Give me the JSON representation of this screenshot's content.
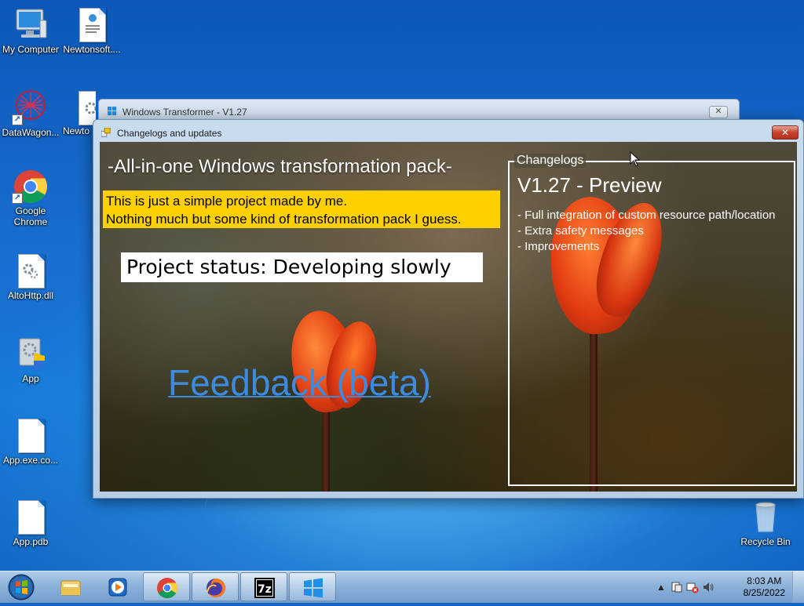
{
  "desktop": {
    "icons": [
      {
        "label": "My Computer",
        "icon": "computer-icon"
      },
      {
        "label": "Newtonsoft....",
        "icon": "document-icon"
      },
      {
        "label": "DataWagon...",
        "icon": "datawagon-icon"
      },
      {
        "label": "Newto",
        "icon": "config-file-icon"
      },
      {
        "label": "Google Chrome",
        "icon": "chrome-icon"
      },
      {
        "label": "AltoHttp.dll",
        "icon": "dll-file-icon"
      },
      {
        "label": "App",
        "icon": "app-icon"
      },
      {
        "label": "App.exe.co...",
        "icon": "blank-file-icon"
      },
      {
        "label": "App.pdb",
        "icon": "blank-file-icon"
      },
      {
        "label": "Recycle Bin",
        "icon": "recycle-bin-icon"
      }
    ]
  },
  "background_window": {
    "title": "Windows Transformer - V1.27",
    "close": "✕"
  },
  "main_window": {
    "title": "Changelogs and updates",
    "close": "✕",
    "heading": "-All-in-one Windows transformation pack-",
    "intro_line1": "This is just a simple project made by me.",
    "intro_line2": "Nothing much but some kind of transformation pack I guess.",
    "status": "Project status: Developing slowly",
    "feedback_link": "Feedback (beta)",
    "changelog": {
      "legend": "Changelogs",
      "version": "V1.27 - Preview",
      "items": [
        "- Full integration of custom resource path/location",
        "- Extra safety messages",
        "- Improvements"
      ]
    }
  },
  "taskbar": {
    "apps": [
      "Windows Explorer",
      "Windows Media Player",
      "Google Chrome",
      "Firefox",
      "7-Zip",
      "Windows Transformer"
    ],
    "active_app": "Windows Transformer",
    "tray_arrow": "▲",
    "time": "8:03 AM",
    "date": "8/25/2022"
  },
  "colors": {
    "intro_bg": "#ffd000",
    "link": "#3d8be0",
    "close_button": "#c7412c"
  }
}
